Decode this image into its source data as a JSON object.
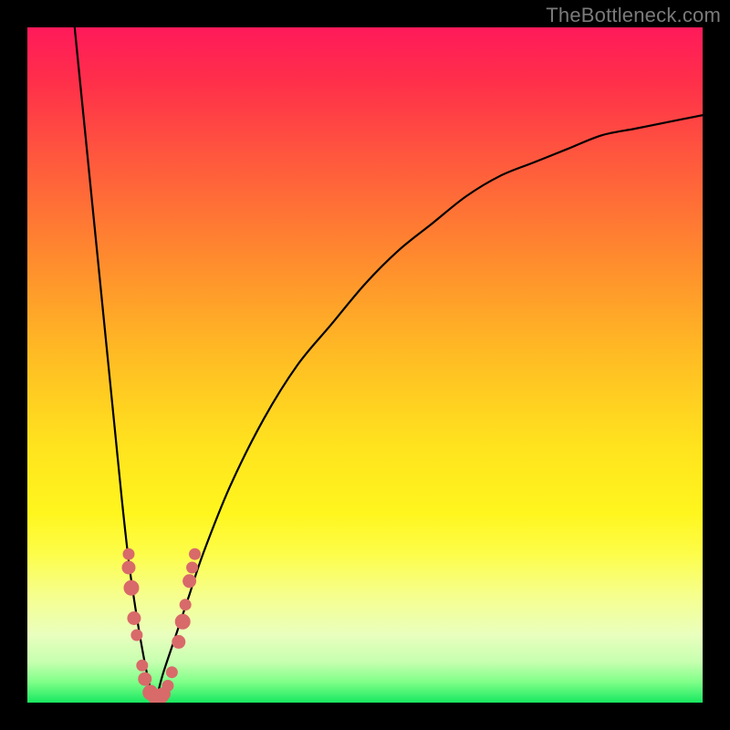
{
  "watermark": "TheBottleneck.com",
  "chart_data": {
    "type": "line",
    "title": "",
    "xlabel": "",
    "ylabel": "",
    "xlim": [
      0,
      100
    ],
    "ylim": [
      0,
      100
    ],
    "grid": false,
    "legend": false,
    "annotations": [],
    "series": [
      {
        "name": "left-branch",
        "x": [
          7,
          8,
          9,
          10,
          11,
          12,
          13,
          14,
          15,
          16,
          17,
          18,
          19
        ],
        "y": [
          100,
          90,
          80,
          70,
          60,
          50,
          40,
          30,
          21,
          14,
          8,
          3,
          0
        ]
      },
      {
        "name": "right-branch",
        "x": [
          19,
          20,
          22,
          24,
          26,
          30,
          35,
          40,
          45,
          50,
          55,
          60,
          65,
          70,
          75,
          80,
          85,
          90,
          95,
          100
        ],
        "y": [
          0,
          4,
          10,
          16,
          22,
          32,
          42,
          50,
          56,
          62,
          67,
          71,
          75,
          78,
          80,
          82,
          84,
          85,
          86,
          87
        ]
      }
    ],
    "scatter_points": {
      "name": "sample-markers",
      "color": "#d86a6a",
      "points": [
        {
          "x": 15.0,
          "y": 22.0,
          "r": 6
        },
        {
          "x": 15.0,
          "y": 20.0,
          "r": 7
        },
        {
          "x": 15.4,
          "y": 17.0,
          "r": 8
        },
        {
          "x": 15.8,
          "y": 12.5,
          "r": 7
        },
        {
          "x": 16.2,
          "y": 10.0,
          "r": 6
        },
        {
          "x": 17.0,
          "y": 5.5,
          "r": 6
        },
        {
          "x": 17.4,
          "y": 3.5,
          "r": 7
        },
        {
          "x": 18.2,
          "y": 1.5,
          "r": 8
        },
        {
          "x": 19.0,
          "y": 0.8,
          "r": 8
        },
        {
          "x": 19.8,
          "y": 1.0,
          "r": 8
        },
        {
          "x": 20.2,
          "y": 1.3,
          "r": 7
        },
        {
          "x": 20.8,
          "y": 2.5,
          "r": 6
        },
        {
          "x": 21.4,
          "y": 4.5,
          "r": 6
        },
        {
          "x": 22.4,
          "y": 9.0,
          "r": 7
        },
        {
          "x": 23.0,
          "y": 12.0,
          "r": 8
        },
        {
          "x": 23.4,
          "y": 14.5,
          "r": 6
        },
        {
          "x": 24.0,
          "y": 18.0,
          "r": 7
        },
        {
          "x": 24.4,
          "y": 20.0,
          "r": 6
        },
        {
          "x": 24.8,
          "y": 22.0,
          "r": 6
        }
      ]
    }
  }
}
